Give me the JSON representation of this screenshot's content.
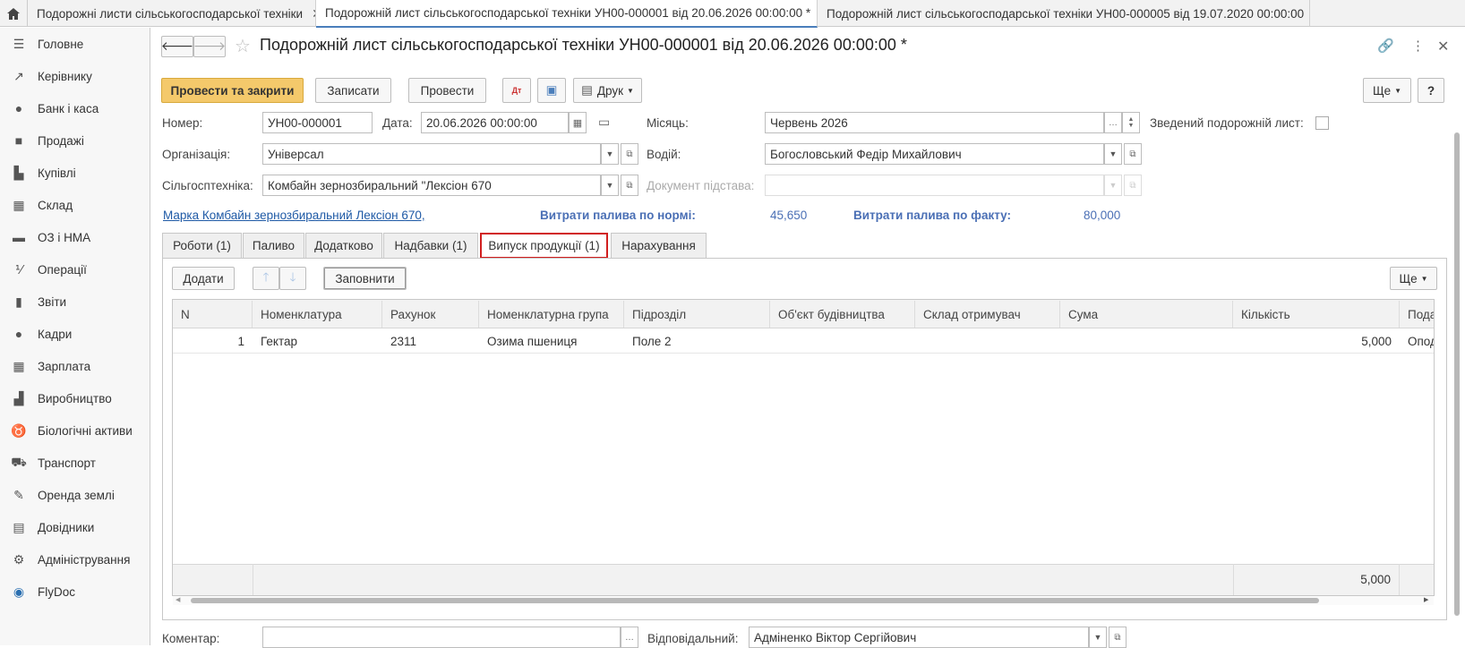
{
  "tabs": [
    {
      "label": "Подорожні листи сільськогосподарської техніки"
    },
    {
      "label": "Подорожній лист сільськогосподарської техніки УН00-000001 від 20.06.2026 00:00:00 *"
    },
    {
      "label": "Подорожній лист сільськогосподарської техніки УН00-000005 від 19.07.2020 00:00:00"
    }
  ],
  "sidebar": {
    "items": [
      {
        "label": "Головне",
        "icon": "menu-icon"
      },
      {
        "label": "Керівнику",
        "icon": "trend-icon"
      },
      {
        "label": "Банк і каса",
        "icon": "coin-icon"
      },
      {
        "label": "Продажі",
        "icon": "bag-icon"
      },
      {
        "label": "Купівлі",
        "icon": "cart-icon"
      },
      {
        "label": "Склад",
        "icon": "warehouse-icon"
      },
      {
        "label": "ОЗ і НМА",
        "icon": "truck-icon"
      },
      {
        "label": "Операції",
        "icon": "dt-kt-icon"
      },
      {
        "label": "Звіти",
        "icon": "bar-chart-icon"
      },
      {
        "label": "Кадри",
        "icon": "person-icon"
      },
      {
        "label": "Зарплата",
        "icon": "calculator-icon"
      },
      {
        "label": "Виробництво",
        "icon": "factory-icon"
      },
      {
        "label": "Біологічні активи",
        "icon": "cow-icon"
      },
      {
        "label": "Транспорт",
        "icon": "tractor-icon"
      },
      {
        "label": "Оренда землі",
        "icon": "pen-icon"
      },
      {
        "label": "Довідники",
        "icon": "books-icon"
      },
      {
        "label": "Адміністрування",
        "icon": "gear-icon"
      },
      {
        "label": "FlyDoc",
        "icon": "flydoc-icon"
      }
    ]
  },
  "doc": {
    "title": "Подорожній лист сільськогосподарської техніки УН00-000001 від 20.06.2026 00:00:00 *"
  },
  "toolbar": {
    "post_close": "Провести та закрити",
    "save": "Записати",
    "post": "Провести",
    "print": "Друк",
    "more": "Ще",
    "help": "?"
  },
  "form": {
    "number_label": "Номер:",
    "number_value": "УН00-000001",
    "date_label": "Дата:",
    "date_value": "20.06.2026 00:00:00",
    "month_label": "Місяць:",
    "month_value": "Червень 2026",
    "summary_label": "Зведений подорожній лист:",
    "org_label": "Організація:",
    "org_value": "Універсал",
    "driver_label": "Водій:",
    "driver_value": "Богословський Федір Михайлович",
    "machine_label": "Сільгосптехніка:",
    "machine_value": "Комбайн зернозбиральний \"Лексіон 670",
    "basis_label": "Документ підстава:",
    "basis_value": "",
    "brand_link": "Марка Комбайн зернозбиральний Лексіон 670,",
    "fuel_norm_label": "Витрати палива по нормі:",
    "fuel_norm_value": "45,650",
    "fuel_fact_label": "Витрати палива по факту:",
    "fuel_fact_value": "80,000",
    "comment_label": "Коментар:",
    "comment_value": "",
    "resp_label": "Відповідальний:",
    "resp_value": "Адміненко Віктор Сергійович"
  },
  "form_tabs": [
    {
      "label": "Роботи (1)"
    },
    {
      "label": "Паливо"
    },
    {
      "label": "Додатково"
    },
    {
      "label": "Надбавки (1)"
    },
    {
      "label": "Випуск продукції (1)"
    },
    {
      "label": "Нарахування"
    }
  ],
  "table_toolbar": {
    "add": "Додати",
    "fill": "Заповнити",
    "more": "Ще"
  },
  "table": {
    "columns": [
      "N",
      "Номенклатура",
      "Рахунок",
      "Номенклатурна група",
      "Підрозділ",
      "Об'єкт будівництва",
      "Склад отримувач",
      "Сума",
      "Кількість",
      "Пода"
    ],
    "rows": [
      {
        "n": "1",
        "nomenclature": "Гектар",
        "account": "2311",
        "group": "Озима пшениця",
        "division": "Поле 2",
        "object": "",
        "warehouse": "",
        "sum": "",
        "qty": "5,000",
        "tax": "Опод"
      }
    ],
    "footer_qty": "5,000"
  }
}
